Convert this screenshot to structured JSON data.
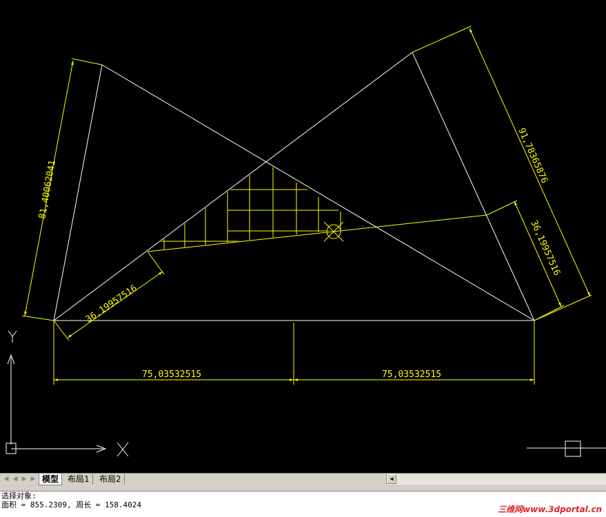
{
  "drawing": {
    "dimensions": {
      "left_edge": "81,40062041",
      "right_edge": "91,78365876",
      "left_lower": "36,19957516",
      "right_lower": "36,19957516",
      "bottom_left": "75,03532515",
      "bottom_right": "75,03532515"
    },
    "ucs": {
      "x_label": "X",
      "y_label": "Y"
    },
    "colors": {
      "background": "#000000",
      "geometry": "#ffffff",
      "dimension": "#ffff00"
    }
  },
  "tabs": {
    "items": [
      {
        "label": "模型",
        "active": true
      },
      {
        "label": "布局1",
        "active": false
      },
      {
        "label": "布局2",
        "active": false
      }
    ]
  },
  "command": {
    "line1": "选择对象:",
    "line2": "面积 = 855.2309, 周长 = 158.4024"
  },
  "watermark": {
    "text": "三维网www.3dportal.cn"
  }
}
